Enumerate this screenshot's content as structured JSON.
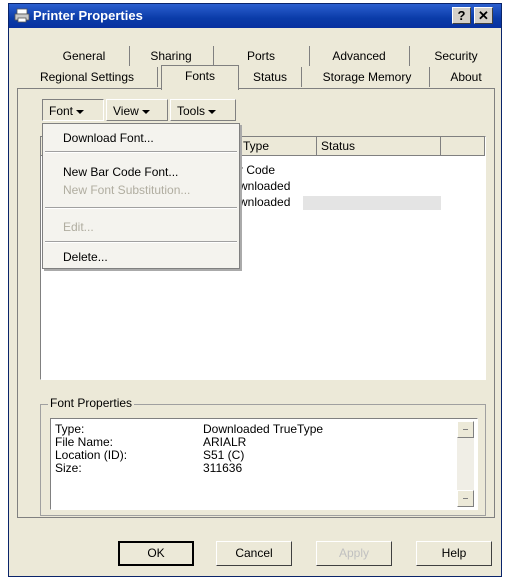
{
  "window": {
    "title": "Printer Properties",
    "help_label": "?",
    "close_label": "✕"
  },
  "tabs": {
    "row1": [
      "General",
      "Sharing",
      "Ports",
      "Advanced",
      "Security"
    ],
    "row2": [
      "Regional Settings",
      "Fonts",
      "Status",
      "Storage Memory",
      "About"
    ],
    "active": "Fonts"
  },
  "menubar": {
    "font": "Font",
    "view": "View",
    "tools": "Tools"
  },
  "font_menu": {
    "download_font": "Download Font...",
    "new_bar_code_font": "New Bar Code Font...",
    "new_font_substitution": "New Font Substitution...",
    "edit": "Edit...",
    "delete": "Delete..."
  },
  "font_list": {
    "columns": [
      "Type",
      "Status"
    ],
    "rows": [
      {
        "type_fragment": "r Code",
        "status": ""
      },
      {
        "type_fragment": "wnloaded",
        "status": ""
      },
      {
        "type_fragment": "wnloaded",
        "status": ""
      }
    ]
  },
  "font_properties": {
    "title": "Font Properties",
    "type_label": "Type:",
    "type_value": "Downloaded TrueType",
    "filename_label": "File Name:",
    "filename_value": "ARIALR",
    "location_label": "Location (ID):",
    "location_value": "S51 (C)",
    "size_label": "Size:",
    "size_value": "311636"
  },
  "buttons": {
    "ok": "OK",
    "cancel": "Cancel",
    "apply": "Apply",
    "help": "Help"
  }
}
